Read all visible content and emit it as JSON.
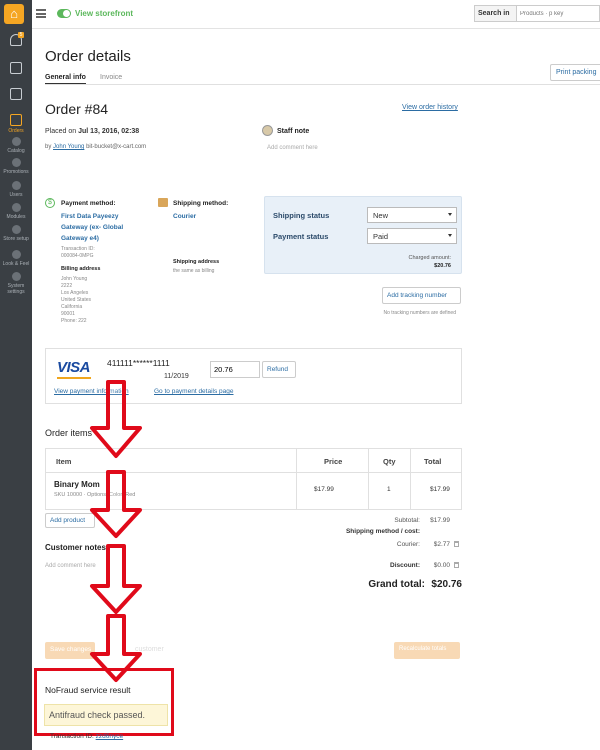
{
  "topbar": {
    "view_storefront": "View storefront",
    "search_in": "Search in",
    "search_placeholder": "Products · p key"
  },
  "sidebar": {
    "notification_count": "5",
    "items": [
      "Orders",
      "Catalog",
      "Promotions",
      "Users",
      "Modules",
      "Store setup",
      "Look & Feel",
      "System settings"
    ]
  },
  "page": {
    "title": "Order details",
    "tabs": [
      "General info",
      "Invoice"
    ],
    "print_packing": "Print packing"
  },
  "order": {
    "title": "Order #84",
    "view_history": "View order history",
    "placed_prefix": "Placed on",
    "placed_date": "Jul 13, 2016, 02:38",
    "by_prefix": "by",
    "customer_name": "John Young",
    "customer_email": "bit-bucket@x-cart.com"
  },
  "staff_note": {
    "title": "Staff note",
    "placeholder": "Add comment here"
  },
  "payment": {
    "label": "Payment method:",
    "name": "First Data Payeezy Gateway (ex- Global Gateway e4)",
    "transaction_label": "Transaction ID:",
    "transaction_id": "000084-0MPG",
    "billing_label": "Billing address",
    "billing_lines": [
      "John Young",
      "2222",
      "Los Angeles",
      "United States",
      "California",
      "90001",
      "Phone: 222"
    ]
  },
  "shipping": {
    "label": "Shipping method:",
    "name": "Courier",
    "address_label": "Shipping address",
    "address_value": "the same as billing"
  },
  "status": {
    "shipping_label": "Shipping status",
    "shipping_value": "New",
    "payment_label": "Payment status",
    "payment_value": "Paid",
    "charged_label": "Charged amount:",
    "charged_value": "$20.76",
    "add_tracking": "Add tracking number",
    "no_tracking": "No tracking numbers are defined"
  },
  "card": {
    "brand": "VISA",
    "number": "411111******1111",
    "expiry": "11/2019",
    "refund_amount": "20.76",
    "refund_button": "Refund",
    "view_payment_info": "View payment information",
    "go_to_details": "Go to payment details page"
  },
  "items": {
    "title": "Order items",
    "headers": [
      "Item",
      "Price",
      "Qty",
      "Total"
    ],
    "rows": [
      {
        "name": "Binary Mom",
        "sku": "SKU 10000 · Options: Color: Red",
        "price": "$17.99",
        "qty": "1",
        "total": "$17.99"
      }
    ],
    "add_product": "Add product"
  },
  "totals": {
    "subtotal_label": "Subtotal:",
    "subtotal_value": "$17.99",
    "shipping_label": "Shipping method / cost:",
    "courier_label": "Courier:",
    "courier_value": "$2.77",
    "discount_label": "Discount:",
    "discount_value": "$0.00",
    "grand_label": "Grand total:",
    "grand_value": "$20.76"
  },
  "customer_notes": {
    "title": "Customer notes",
    "placeholder": "Add comment here"
  },
  "bottom": {
    "save_button": "Save changes",
    "customer_faded": "customer",
    "recalculate_button": "Recalculate totals"
  },
  "nofraud": {
    "title": "NoFraud service result",
    "result": "Antifraud check passed.",
    "transaction_label": "Transaction ID:",
    "transaction_id": "zzd6nyce"
  },
  "colors": {
    "accent": "#f5a623",
    "link": "#2b6ca3",
    "highlight_red": "#e00a1a",
    "storefront_green": "#5cb85c"
  }
}
